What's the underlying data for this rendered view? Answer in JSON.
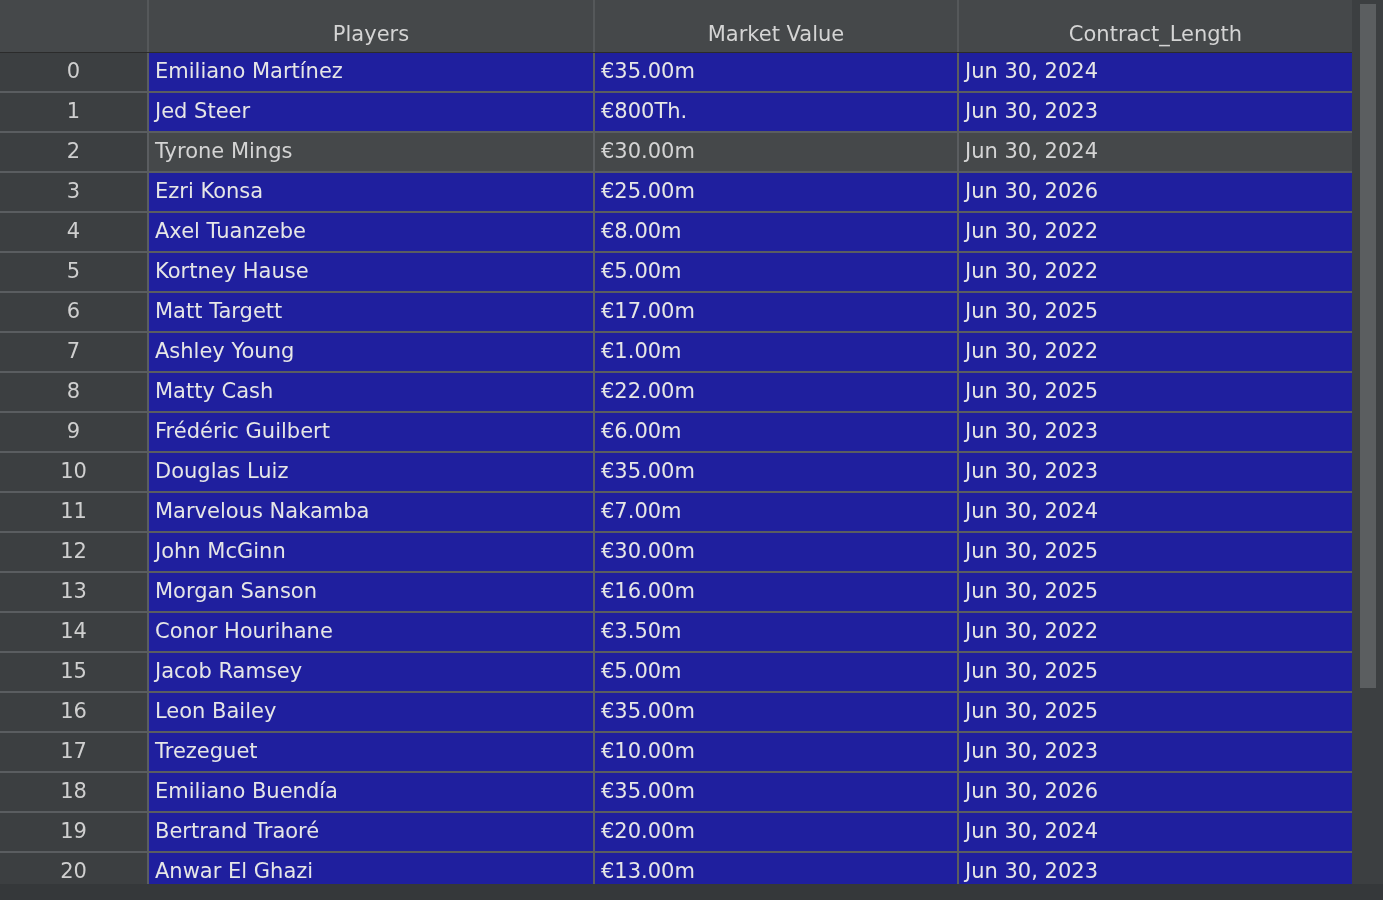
{
  "table": {
    "columns": [
      "Players",
      "Market Value",
      "Contract_Length"
    ],
    "rows": [
      {
        "index": "0",
        "cells": [
          "Emiliano Martínez",
          "€35.00m",
          "Jun 30, 2024"
        ],
        "selected": true
      },
      {
        "index": "1",
        "cells": [
          "Jed Steer",
          "€800Th.",
          "Jun 30, 2023"
        ],
        "selected": true
      },
      {
        "index": "2",
        "cells": [
          "Tyrone Mings",
          "€30.00m",
          "Jun 30, 2024"
        ],
        "selected": false
      },
      {
        "index": "3",
        "cells": [
          "Ezri Konsa",
          "€25.00m",
          "Jun 30, 2026"
        ],
        "selected": true
      },
      {
        "index": "4",
        "cells": [
          "Axel Tuanzebe",
          "€8.00m",
          "Jun 30, 2022"
        ],
        "selected": true
      },
      {
        "index": "5",
        "cells": [
          "Kortney Hause",
          "€5.00m",
          "Jun 30, 2022"
        ],
        "selected": true
      },
      {
        "index": "6",
        "cells": [
          "Matt Targett",
          "€17.00m",
          "Jun 30, 2025"
        ],
        "selected": true
      },
      {
        "index": "7",
        "cells": [
          "Ashley Young",
          "€1.00m",
          "Jun 30, 2022"
        ],
        "selected": true
      },
      {
        "index": "8",
        "cells": [
          "Matty Cash",
          "€22.00m",
          "Jun 30, 2025"
        ],
        "selected": true
      },
      {
        "index": "9",
        "cells": [
          "Frédéric Guilbert",
          "€6.00m",
          "Jun 30, 2023"
        ],
        "selected": true
      },
      {
        "index": "10",
        "cells": [
          "Douglas Luiz",
          "€35.00m",
          "Jun 30, 2023"
        ],
        "selected": true
      },
      {
        "index": "11",
        "cells": [
          "Marvelous Nakamba",
          "€7.00m",
          "Jun 30, 2024"
        ],
        "selected": true
      },
      {
        "index": "12",
        "cells": [
          "John McGinn",
          "€30.00m",
          "Jun 30, 2025"
        ],
        "selected": true
      },
      {
        "index": "13",
        "cells": [
          "Morgan Sanson",
          "€16.00m",
          "Jun 30, 2025"
        ],
        "selected": true
      },
      {
        "index": "14",
        "cells": [
          "Conor Hourihane",
          "€3.50m",
          "Jun 30, 2022"
        ],
        "selected": true
      },
      {
        "index": "15",
        "cells": [
          "Jacob Ramsey",
          "€5.00m",
          "Jun 30, 2025"
        ],
        "selected": true
      },
      {
        "index": "16",
        "cells": [
          "Leon Bailey",
          "€35.00m",
          "Jun 30, 2025"
        ],
        "selected": true
      },
      {
        "index": "17",
        "cells": [
          "Trezeguet",
          "€10.00m",
          "Jun 30, 2023"
        ],
        "selected": true
      },
      {
        "index": "18",
        "cells": [
          "Emiliano Buendía",
          "€35.00m",
          "Jun 30, 2026"
        ],
        "selected": true
      },
      {
        "index": "19",
        "cells": [
          "Bertrand Traoré",
          "€20.00m",
          "Jun 30, 2024"
        ],
        "selected": true
      },
      {
        "index": "20",
        "cells": [
          "Anwar El Ghazi",
          "€13.00m",
          "Jun 30, 2023"
        ],
        "selected": true
      }
    ]
  }
}
